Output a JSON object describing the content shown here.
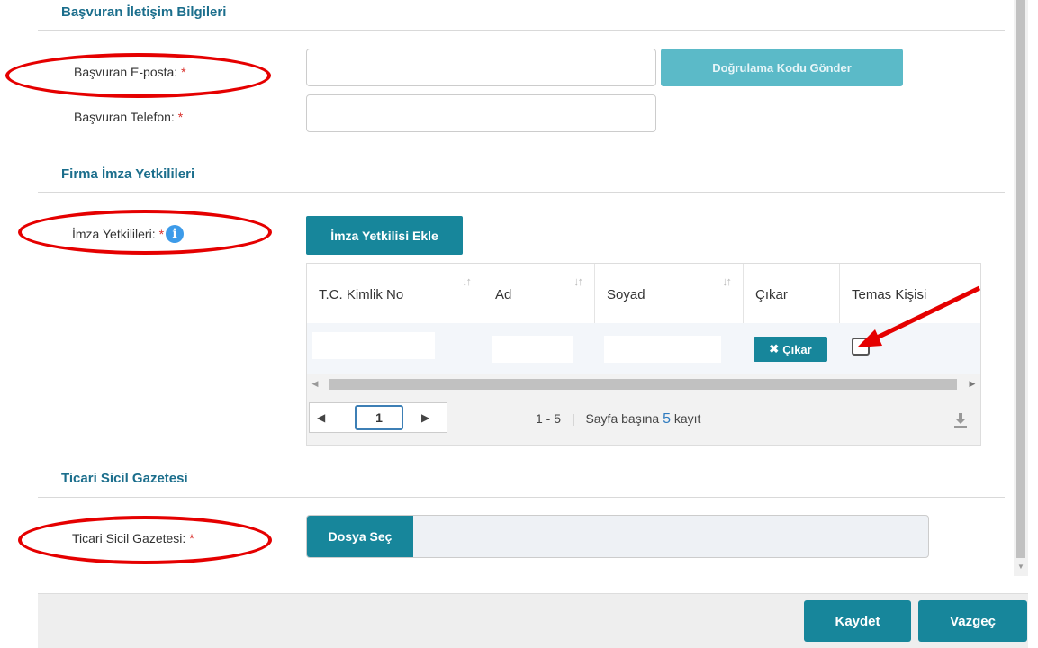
{
  "contact_section": {
    "title": "Başvuran İletişim Bilgileri",
    "email_label": "Başvuran E-posta:",
    "phone_label": "Başvuran Telefon:",
    "email_value": "",
    "phone_value": "",
    "verify_button": "Doğrulama Kodu Gönder",
    "required_mark": "*"
  },
  "signatories_section": {
    "title": "Firma İmza Yetkilileri",
    "label": "İmza Yetkilileri:",
    "required_mark": "*",
    "info_icon": "info-icon",
    "add_button": "İmza Yetkilisi Ekle",
    "grid": {
      "columns": [
        "T.C. Kimlik No",
        "Ad",
        "Soyad",
        "Çıkar",
        "Temas Kişisi"
      ],
      "sort_glyph": "↓↑",
      "rows": [
        {
          "tc": "",
          "ad": "",
          "soyad": "",
          "remove_label": "Çıkar",
          "contact": false
        }
      ],
      "pager": {
        "current_page": "1",
        "range": "1 - 5",
        "separator": "|",
        "per_page_prefix": "Sayfa başına",
        "per_page_value": "5",
        "per_page_suffix": "kayıt"
      }
    }
  },
  "gazette_section": {
    "title": "Ticari Sicil Gazetesi",
    "label": "Ticari Sicil Gazetesi:",
    "required_mark": "*",
    "choose_file_button": "Dosya Seç"
  },
  "footer": {
    "save_button": "Kaydet",
    "cancel_button": "Vazgeç"
  },
  "colors": {
    "section_title": "#1b6e8c",
    "teal_button": "#17869b",
    "annotation_red": "#e50000"
  }
}
